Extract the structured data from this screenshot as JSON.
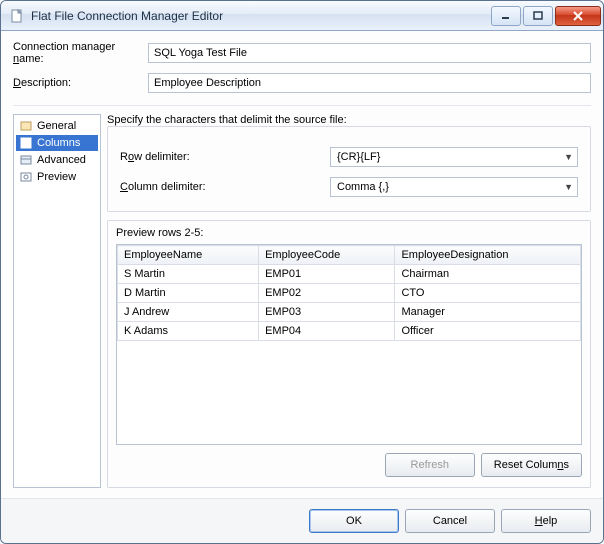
{
  "window": {
    "title": "Flat File Connection Manager Editor"
  },
  "form": {
    "name_label_pre": "Connection manager ",
    "name_label_u": "n",
    "name_label_post": "ame:",
    "name_value": "SQL Yoga Test File",
    "desc_label_u": "D",
    "desc_label_post": "escription:",
    "desc_value": "Employee Description"
  },
  "sidebar": {
    "items": [
      {
        "label": "General"
      },
      {
        "label": "Columns"
      },
      {
        "label": "Advanced"
      },
      {
        "label": "Preview"
      }
    ]
  },
  "delimiters": {
    "heading": "Specify the characters that delimit the source file:",
    "row_label_pre": "R",
    "row_label_u": "o",
    "row_label_post": "w delimiter:",
    "row_value": "{CR}{LF}",
    "col_label_u": "C",
    "col_label_post": "olumn delimiter:",
    "col_value": "Comma {,}"
  },
  "preview": {
    "label": "Preview rows 2-5:",
    "headers": [
      "EmployeeName",
      "EmployeeCode",
      "EmployeeDesignation"
    ],
    "rows": [
      [
        "S Martin",
        "EMP01",
        "Chairman"
      ],
      [
        "D Martin",
        "EMP02",
        "CTO"
      ],
      [
        "J Andrew",
        "EMP03",
        "Manager"
      ],
      [
        "K Adams",
        "EMP04",
        "Officer"
      ]
    ]
  },
  "buttons": {
    "refresh": "Refresh",
    "reset_pre": "Reset Colum",
    "reset_u": "n",
    "reset_post": "s",
    "ok": "OK",
    "cancel": "Cancel",
    "help_u": "H",
    "help_post": "elp"
  }
}
